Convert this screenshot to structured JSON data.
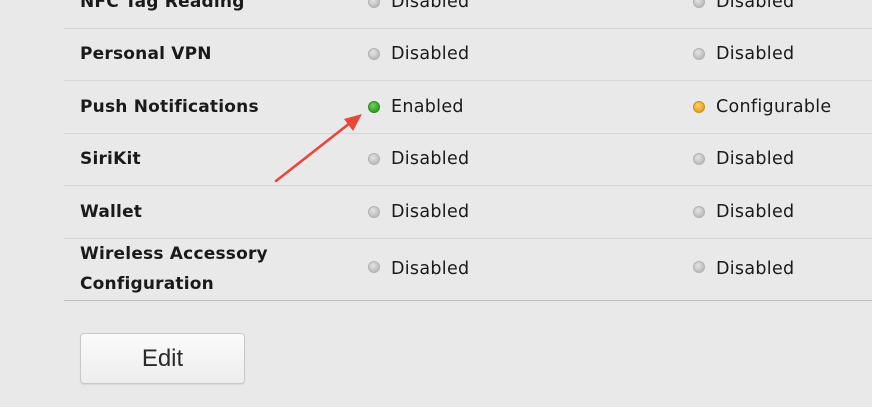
{
  "capabilities": [
    {
      "name": "NFC Tag Reading",
      "development": "Disabled",
      "distribution": "Disabled",
      "dev_status": "off",
      "dist_status": "off"
    },
    {
      "name": "Personal VPN",
      "development": "Disabled",
      "distribution": "Disabled",
      "dev_status": "off",
      "dist_status": "off"
    },
    {
      "name": "Push Notifications",
      "development": "Enabled",
      "distribution": "Configurable",
      "dev_status": "on",
      "dist_status": "configurable"
    },
    {
      "name": "SiriKit",
      "development": "Disabled",
      "distribution": "Disabled",
      "dev_status": "off",
      "dist_status": "off"
    },
    {
      "name": "Wallet",
      "development": "Disabled",
      "distribution": "Disabled",
      "dev_status": "off",
      "dist_status": "off"
    },
    {
      "name": "Wireless Accessory Configuration",
      "development": "Disabled",
      "distribution": "Disabled",
      "dev_status": "off",
      "dist_status": "off"
    }
  ],
  "edit_button": {
    "label": "Edit"
  },
  "colors": {
    "enabled": "#3aa62a",
    "configurable": "#e8ab2a",
    "disabled": "#c4c4c4",
    "annotation_arrow": "#e8473a"
  },
  "icons": {
    "status_off": "gray-dot-icon",
    "status_on": "green-dot-icon",
    "status_configurable": "yellow-dot-icon",
    "annotation": "red-arrow-icon"
  }
}
